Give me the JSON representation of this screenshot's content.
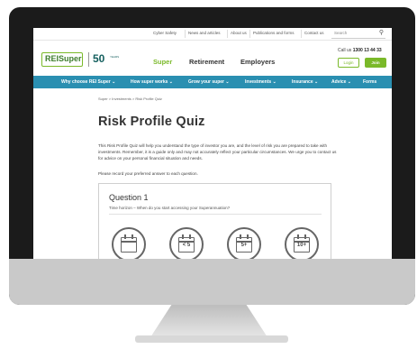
{
  "utility_links": [
    "Cyber Safety",
    "News and articles",
    "About us",
    "Publications and forms",
    "Contact us"
  ],
  "search": {
    "placeholder": "Search",
    "icon": "search-icon"
  },
  "logo": {
    "brand": "REISuper",
    "anniversary": "50",
    "anniversary_sub": "YEARS"
  },
  "main_nav": [
    "Super",
    "Retirement",
    "Employers"
  ],
  "call_us": {
    "label": "Call us",
    "number": "1300 13 44 33"
  },
  "buttons": {
    "login": "Login",
    "join": "Join"
  },
  "blue_nav": [
    "Why choose REI Super ⌄",
    "How super works ⌄",
    "Grow your super ⌄",
    "Investments ⌄",
    "Insurance ⌄",
    "Advice ⌄",
    "Forms"
  ],
  "breadcrumb": "Super  >  Investments  >  Risk Profile Quiz",
  "page_title": "Risk Profile Quiz",
  "intro": "This Risk Profile Quiz will help you understand the type of investor you are, and the level of risk you are prepared to take with investments. Remember, it is a guide only and may not accurately reflect your particular circumstances. We urge you to contact us for advice on your personal financial situation and needs.",
  "instruction": "Please record your preferred answer to each question.",
  "question": {
    "title": "Question 1",
    "text": "Time horizon – When do you start accessing your Superannuation?",
    "options": [
      "",
      "< 5",
      "5+",
      "10+"
    ]
  },
  "colors": {
    "accent_green": "#7ab929",
    "nav_blue": "#2a8fb1",
    "monitor": "#1b1b1b"
  }
}
